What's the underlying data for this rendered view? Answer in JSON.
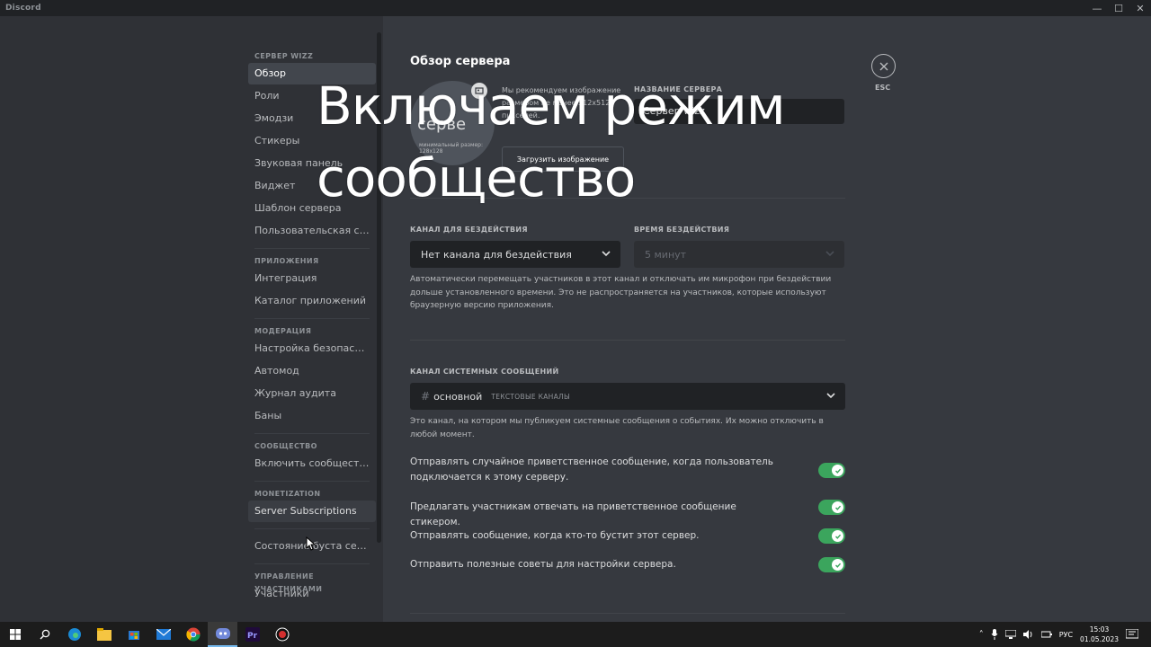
{
  "window": {
    "app_name": "Discord",
    "minimize": "—",
    "maximize": "☐",
    "close": "✕"
  },
  "sidebar": {
    "sections": [
      {
        "header": "СЕРВЕР wizz",
        "items": [
          "Обзор",
          "Роли",
          "Эмодзи",
          "Стикеры",
          "Звуковая панель",
          "Виджет",
          "Шаблон сервера",
          "Пользовательская сс..."
        ]
      },
      {
        "header": "ПРИЛОЖЕНИЯ",
        "items": [
          "Интеграция",
          "Каталог приложений"
        ]
      },
      {
        "header": "МОДЕРАЦИЯ",
        "items": [
          "Настройка безопасно...",
          "Автомод",
          "Журнал аудита",
          "Баны"
        ]
      },
      {
        "header": "СООБЩЕСТВО",
        "items": [
          "Включить сообщество"
        ]
      },
      {
        "header": "MONETIZATION",
        "items": [
          "Server Subscriptions"
        ]
      },
      {
        "header": "",
        "items": [
          "Состояние буста сервера"
        ]
      },
      {
        "header": "УПРАВЛЕНИЕ УЧАСТНИКАМИ",
        "items": [
          "Участники"
        ]
      }
    ]
  },
  "main": {
    "title": "Обзор сервера",
    "icon_hint": "Мы рекомендуем изображение размером не менее 512x512 пикселей.",
    "icon_placeholder": "серве",
    "min_size": "минимальный размер: 128x128",
    "upload_button": "Загрузить изображение",
    "server_name_label": "НАЗВАНИЕ СЕРВЕРА",
    "server_name_value": "Сервер wizz",
    "afk_channel_label": "КАНАЛ ДЛЯ БЕЗДЕЙСТВИЯ",
    "afk_channel_value": "Нет канала для бездействия",
    "afk_timeout_label": "ВРЕМЯ БЕЗДЕЙСТВИЯ",
    "afk_timeout_value": "5 минут",
    "afk_description": "Автоматически перемещать участников в этот канал и отключать им микрофон при бездействии дольше установленного времени. Это не распространяется на участников, которые используют браузерную версию приложения.",
    "system_channel_label": "КАНАЛ СИСТЕМНЫХ СООБЩЕНИЙ",
    "system_channel_hash": "#",
    "system_channel_name": "основной",
    "system_channel_category": "ТЕКСТОВЫЕ КАНАЛЫ",
    "system_channel_description": "Это канал, на котором мы публикуем системные сообщения о событиях. Их можно отключить в любой момент.",
    "toggles": [
      {
        "label": "Отправлять случайное приветственное сообщение, когда пользователь подключается к этому серверу.",
        "on": true
      },
      {
        "label": "Предлагать участникам отвечать на приветственное сообщение стикером.",
        "on": true
      },
      {
        "label": "Отправлять сообщение, когда кто-то бустит этот сервер.",
        "on": true
      },
      {
        "label": "Отправить полезные советы для настройки сервера.",
        "on": true
      }
    ],
    "esc_label": "ESC"
  },
  "overlay": {
    "line1": "Включаем режим",
    "line2": "сообщество"
  },
  "taskbar": {
    "tray_lang": "РУС",
    "time": "15:03",
    "date": "01.05.2023"
  },
  "colors": {
    "toggle_on": "#3ba55d",
    "sidebar_bg": "#2f3136",
    "content_bg": "#36393f"
  }
}
